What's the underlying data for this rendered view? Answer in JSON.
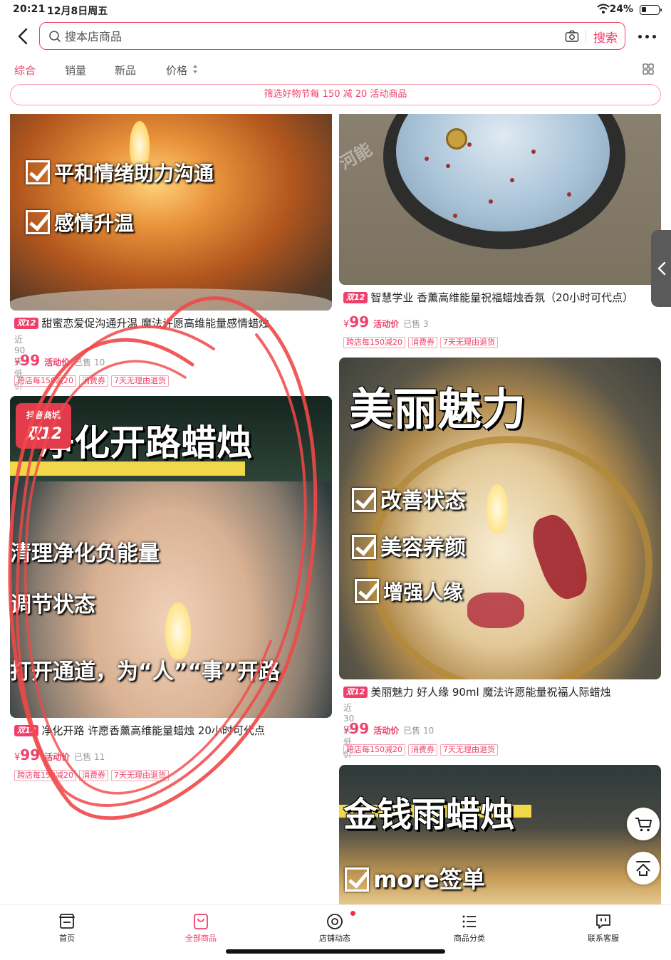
{
  "status_bar": {
    "time": "20:21",
    "date": "12月8日周五",
    "battery": "24%"
  },
  "search": {
    "placeholder": "搜本店商品",
    "button": "搜索"
  },
  "sort_tabs": [
    {
      "label": "综合",
      "active": true
    },
    {
      "label": "销量",
      "active": false
    },
    {
      "label": "新品",
      "active": false
    },
    {
      "label": "价格",
      "active": false
    }
  ],
  "promo_banner": "筛选好物节每 150 减 20 活动商品",
  "products": [
    {
      "badge": "双12",
      "title": "甜蜜恋爱促沟通升温 魔法许愿高维能量感情蜡烛",
      "low_price_note": "近90天低价",
      "currency": "¥",
      "price": "99",
      "price_label": "活动价",
      "sold": "已售 10",
      "tags": [
        "跨店每150减20",
        "消费券",
        "7天无理由退货"
      ],
      "image_lines": [
        "平和情绪助力沟通",
        "感情升温"
      ]
    },
    {
      "badge": "双12",
      "title": "智慧学业 香薰高维能量祝福蜡烛香氛（20小时可代点）",
      "currency": "¥",
      "price": "99",
      "price_label": "活动价",
      "sold": "已售 3",
      "tags": [
        "跨店每150减20",
        "消费券",
        "7天无理由退货"
      ],
      "image_watermark": "河能"
    },
    {
      "badge": "双12",
      "title": "净化开路 许愿香薰高维能量蜡烛 20小时可代点",
      "currency": "¥",
      "price": "99",
      "price_label": "活动价",
      "sold": "已售 11",
      "tags": [
        "跨店每150减20",
        "消费券",
        "7天无理由退货"
      ],
      "image_header": "净化开路蜡烛",
      "image_sticker": [
        "抖音商城",
        "双12"
      ],
      "image_lines": [
        "清理净化负能量",
        "调节状态",
        "打开通道，为“人”“事”开路"
      ]
    },
    {
      "badge": "双12",
      "title": "美丽魅力 好人缘  90ml 魔法许愿能量祝福人际蜡烛",
      "low_price_note": "近30天低价",
      "currency": "¥",
      "price": "99",
      "price_label": "活动价",
      "sold": "已售 10",
      "tags": [
        "跨店每150减20",
        "消费券",
        "7天无理由退货"
      ],
      "image_header": "美丽魅力",
      "image_lines": [
        "改善状态",
        "美容养颜",
        "增强人缘"
      ]
    },
    {
      "image_header": "金钱雨蜡烛",
      "image_lines": [
        "more签单"
      ]
    }
  ],
  "bottom_nav": [
    {
      "label": "首页",
      "icon": "store-icon",
      "active": false
    },
    {
      "label": "全部商品",
      "icon": "bag-icon",
      "active": true
    },
    {
      "label": "店铺动态",
      "icon": "camera-circle-icon",
      "active": false
    },
    {
      "label": "商品分类",
      "icon": "list-icon",
      "active": false
    },
    {
      "label": "联系客服",
      "icon": "chat-icon",
      "active": false
    }
  ],
  "colors": {
    "accent": "#f0406a",
    "ink_circle": "#f04848"
  }
}
